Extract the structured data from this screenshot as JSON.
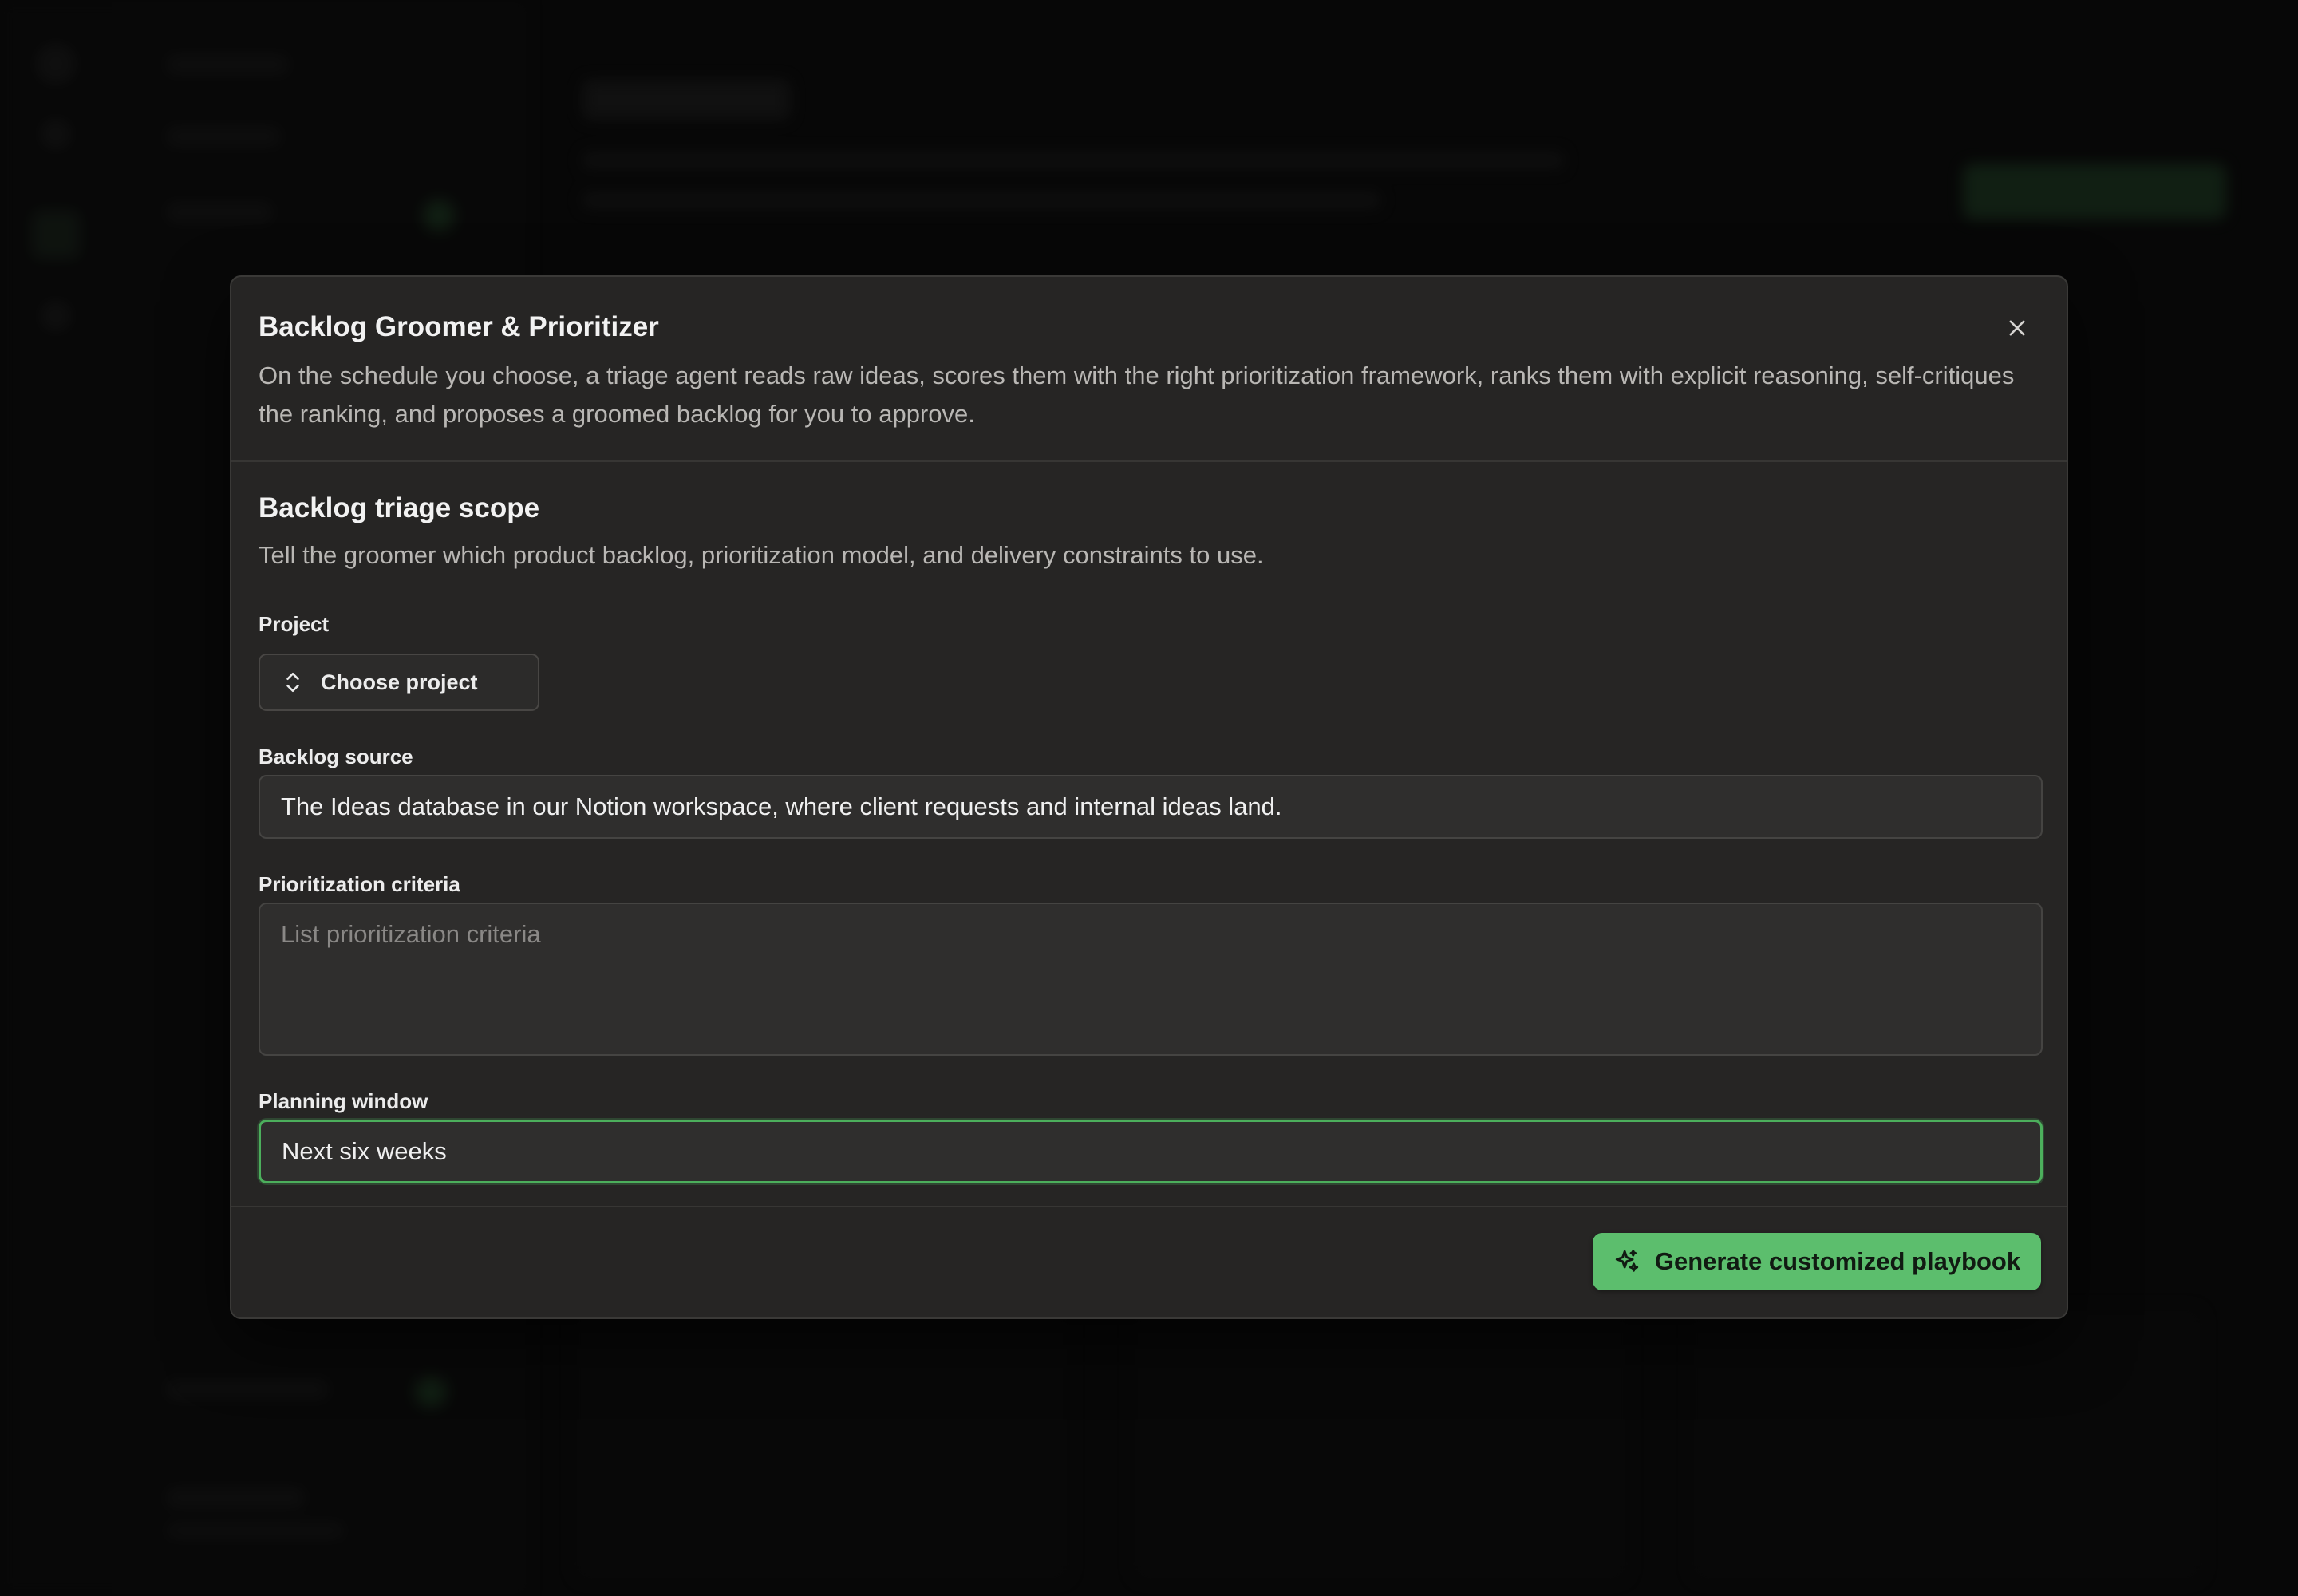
{
  "modal": {
    "title": "Backlog Groomer & Prioritizer",
    "description": "On the schedule you choose, a triage agent reads raw ideas, scores them with the right prioritization framework, ranks them with explicit reasoning, self-critiques the ranking, and proposes a groomed backlog for you to approve.",
    "close_icon": "close-icon"
  },
  "scope": {
    "title": "Backlog triage scope",
    "description": "Tell the groomer which product backlog, prioritization model, and delivery constraints to use."
  },
  "fields": {
    "project": {
      "label": "Project",
      "button_label": "Choose project",
      "icon": "chevron-up-down-icon"
    },
    "backlog_source": {
      "label": "Backlog source",
      "value": "The Ideas database in our Notion workspace, where client requests and internal ideas land."
    },
    "prioritization_criteria": {
      "label": "Prioritization criteria",
      "value": "",
      "placeholder": "List prioritization criteria"
    },
    "planning_window": {
      "label": "Planning window",
      "value": "Next six weeks"
    }
  },
  "footer": {
    "generate_label": "Generate customized playbook",
    "generate_icon": "sparkles-icon"
  },
  "colors": {
    "accent": "#5cbe6d",
    "focus_border": "#4caf5c",
    "modal_bg": "#262524"
  }
}
